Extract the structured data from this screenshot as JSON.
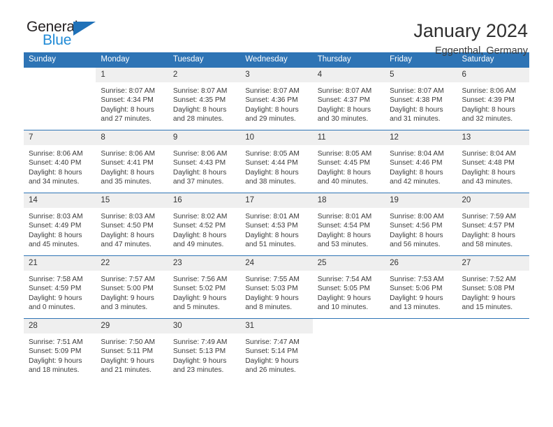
{
  "brand": {
    "word_one": "General",
    "word_two": "Blue",
    "triangle_icon": "triangle-icon",
    "color_dark": "#231f20",
    "color_blue": "#1f8ad6",
    "color_triangle": "#1f71b8"
  },
  "header": {
    "title": "January 2024",
    "subtitle": "Eggenthal, Germany"
  },
  "theme": {
    "header_bg": "#2e74b5",
    "header_text": "#ffffff",
    "daynum_bg": "#efefef",
    "rule_color": "#2e74b5"
  },
  "weekday_headers": [
    "Sunday",
    "Monday",
    "Tuesday",
    "Wednesday",
    "Thursday",
    "Friday",
    "Saturday"
  ],
  "weeks": [
    [
      {
        "day": "",
        "sunrise": "",
        "sunset": "",
        "daylight_line1": "",
        "daylight_line2": "",
        "empty": true
      },
      {
        "day": "1",
        "sunrise": "Sunrise: 8:07 AM",
        "sunset": "Sunset: 4:34 PM",
        "daylight_line1": "Daylight: 8 hours",
        "daylight_line2": "and 27 minutes."
      },
      {
        "day": "2",
        "sunrise": "Sunrise: 8:07 AM",
        "sunset": "Sunset: 4:35 PM",
        "daylight_line1": "Daylight: 8 hours",
        "daylight_line2": "and 28 minutes."
      },
      {
        "day": "3",
        "sunrise": "Sunrise: 8:07 AM",
        "sunset": "Sunset: 4:36 PM",
        "daylight_line1": "Daylight: 8 hours",
        "daylight_line2": "and 29 minutes."
      },
      {
        "day": "4",
        "sunrise": "Sunrise: 8:07 AM",
        "sunset": "Sunset: 4:37 PM",
        "daylight_line1": "Daylight: 8 hours",
        "daylight_line2": "and 30 minutes."
      },
      {
        "day": "5",
        "sunrise": "Sunrise: 8:07 AM",
        "sunset": "Sunset: 4:38 PM",
        "daylight_line1": "Daylight: 8 hours",
        "daylight_line2": "and 31 minutes."
      },
      {
        "day": "6",
        "sunrise": "Sunrise: 8:06 AM",
        "sunset": "Sunset: 4:39 PM",
        "daylight_line1": "Daylight: 8 hours",
        "daylight_line2": "and 32 minutes."
      }
    ],
    [
      {
        "day": "7",
        "sunrise": "Sunrise: 8:06 AM",
        "sunset": "Sunset: 4:40 PM",
        "daylight_line1": "Daylight: 8 hours",
        "daylight_line2": "and 34 minutes."
      },
      {
        "day": "8",
        "sunrise": "Sunrise: 8:06 AM",
        "sunset": "Sunset: 4:41 PM",
        "daylight_line1": "Daylight: 8 hours",
        "daylight_line2": "and 35 minutes."
      },
      {
        "day": "9",
        "sunrise": "Sunrise: 8:06 AM",
        "sunset": "Sunset: 4:43 PM",
        "daylight_line1": "Daylight: 8 hours",
        "daylight_line2": "and 37 minutes."
      },
      {
        "day": "10",
        "sunrise": "Sunrise: 8:05 AM",
        "sunset": "Sunset: 4:44 PM",
        "daylight_line1": "Daylight: 8 hours",
        "daylight_line2": "and 38 minutes."
      },
      {
        "day": "11",
        "sunrise": "Sunrise: 8:05 AM",
        "sunset": "Sunset: 4:45 PM",
        "daylight_line1": "Daylight: 8 hours",
        "daylight_line2": "and 40 minutes."
      },
      {
        "day": "12",
        "sunrise": "Sunrise: 8:04 AM",
        "sunset": "Sunset: 4:46 PM",
        "daylight_line1": "Daylight: 8 hours",
        "daylight_line2": "and 42 minutes."
      },
      {
        "day": "13",
        "sunrise": "Sunrise: 8:04 AM",
        "sunset": "Sunset: 4:48 PM",
        "daylight_line1": "Daylight: 8 hours",
        "daylight_line2": "and 43 minutes."
      }
    ],
    [
      {
        "day": "14",
        "sunrise": "Sunrise: 8:03 AM",
        "sunset": "Sunset: 4:49 PM",
        "daylight_line1": "Daylight: 8 hours",
        "daylight_line2": "and 45 minutes."
      },
      {
        "day": "15",
        "sunrise": "Sunrise: 8:03 AM",
        "sunset": "Sunset: 4:50 PM",
        "daylight_line1": "Daylight: 8 hours",
        "daylight_line2": "and 47 minutes."
      },
      {
        "day": "16",
        "sunrise": "Sunrise: 8:02 AM",
        "sunset": "Sunset: 4:52 PM",
        "daylight_line1": "Daylight: 8 hours",
        "daylight_line2": "and 49 minutes."
      },
      {
        "day": "17",
        "sunrise": "Sunrise: 8:01 AM",
        "sunset": "Sunset: 4:53 PM",
        "daylight_line1": "Daylight: 8 hours",
        "daylight_line2": "and 51 minutes."
      },
      {
        "day": "18",
        "sunrise": "Sunrise: 8:01 AM",
        "sunset": "Sunset: 4:54 PM",
        "daylight_line1": "Daylight: 8 hours",
        "daylight_line2": "and 53 minutes."
      },
      {
        "day": "19",
        "sunrise": "Sunrise: 8:00 AM",
        "sunset": "Sunset: 4:56 PM",
        "daylight_line1": "Daylight: 8 hours",
        "daylight_line2": "and 56 minutes."
      },
      {
        "day": "20",
        "sunrise": "Sunrise: 7:59 AM",
        "sunset": "Sunset: 4:57 PM",
        "daylight_line1": "Daylight: 8 hours",
        "daylight_line2": "and 58 minutes."
      }
    ],
    [
      {
        "day": "21",
        "sunrise": "Sunrise: 7:58 AM",
        "sunset": "Sunset: 4:59 PM",
        "daylight_line1": "Daylight: 9 hours",
        "daylight_line2": "and 0 minutes."
      },
      {
        "day": "22",
        "sunrise": "Sunrise: 7:57 AM",
        "sunset": "Sunset: 5:00 PM",
        "daylight_line1": "Daylight: 9 hours",
        "daylight_line2": "and 3 minutes."
      },
      {
        "day": "23",
        "sunrise": "Sunrise: 7:56 AM",
        "sunset": "Sunset: 5:02 PM",
        "daylight_line1": "Daylight: 9 hours",
        "daylight_line2": "and 5 minutes."
      },
      {
        "day": "24",
        "sunrise": "Sunrise: 7:55 AM",
        "sunset": "Sunset: 5:03 PM",
        "daylight_line1": "Daylight: 9 hours",
        "daylight_line2": "and 8 minutes."
      },
      {
        "day": "25",
        "sunrise": "Sunrise: 7:54 AM",
        "sunset": "Sunset: 5:05 PM",
        "daylight_line1": "Daylight: 9 hours",
        "daylight_line2": "and 10 minutes."
      },
      {
        "day": "26",
        "sunrise": "Sunrise: 7:53 AM",
        "sunset": "Sunset: 5:06 PM",
        "daylight_line1": "Daylight: 9 hours",
        "daylight_line2": "and 13 minutes."
      },
      {
        "day": "27",
        "sunrise": "Sunrise: 7:52 AM",
        "sunset": "Sunset: 5:08 PM",
        "daylight_line1": "Daylight: 9 hours",
        "daylight_line2": "and 15 minutes."
      }
    ],
    [
      {
        "day": "28",
        "sunrise": "Sunrise: 7:51 AM",
        "sunset": "Sunset: 5:09 PM",
        "daylight_line1": "Daylight: 9 hours",
        "daylight_line2": "and 18 minutes."
      },
      {
        "day": "29",
        "sunrise": "Sunrise: 7:50 AM",
        "sunset": "Sunset: 5:11 PM",
        "daylight_line1": "Daylight: 9 hours",
        "daylight_line2": "and 21 minutes."
      },
      {
        "day": "30",
        "sunrise": "Sunrise: 7:49 AM",
        "sunset": "Sunset: 5:13 PM",
        "daylight_line1": "Daylight: 9 hours",
        "daylight_line2": "and 23 minutes."
      },
      {
        "day": "31",
        "sunrise": "Sunrise: 7:47 AM",
        "sunset": "Sunset: 5:14 PM",
        "daylight_line1": "Daylight: 9 hours",
        "daylight_line2": "and 26 minutes."
      },
      {
        "day": "",
        "sunrise": "",
        "sunset": "",
        "daylight_line1": "",
        "daylight_line2": "",
        "empty": true
      },
      {
        "day": "",
        "sunrise": "",
        "sunset": "",
        "daylight_line1": "",
        "daylight_line2": "",
        "empty": true
      },
      {
        "day": "",
        "sunrise": "",
        "sunset": "",
        "daylight_line1": "",
        "daylight_line2": "",
        "empty": true
      }
    ]
  ]
}
